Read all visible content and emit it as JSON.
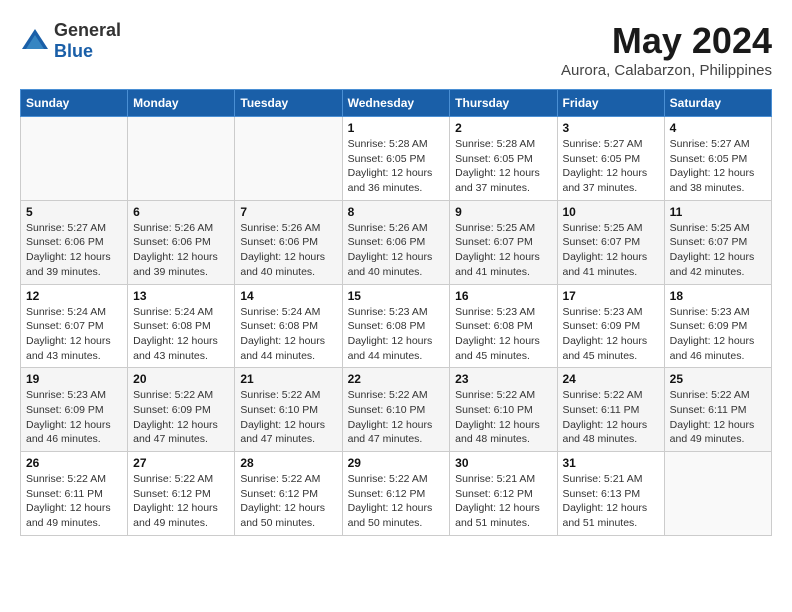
{
  "logo": {
    "general": "General",
    "blue": "Blue"
  },
  "title": "May 2024",
  "location": "Aurora, Calabarzon, Philippines",
  "days_header": [
    "Sunday",
    "Monday",
    "Tuesday",
    "Wednesday",
    "Thursday",
    "Friday",
    "Saturday"
  ],
  "weeks": [
    [
      {
        "day": "",
        "info": ""
      },
      {
        "day": "",
        "info": ""
      },
      {
        "day": "",
        "info": ""
      },
      {
        "day": "1",
        "info": "Sunrise: 5:28 AM\nSunset: 6:05 PM\nDaylight: 12 hours\nand 36 minutes."
      },
      {
        "day": "2",
        "info": "Sunrise: 5:28 AM\nSunset: 6:05 PM\nDaylight: 12 hours\nand 37 minutes."
      },
      {
        "day": "3",
        "info": "Sunrise: 5:27 AM\nSunset: 6:05 PM\nDaylight: 12 hours\nand 37 minutes."
      },
      {
        "day": "4",
        "info": "Sunrise: 5:27 AM\nSunset: 6:05 PM\nDaylight: 12 hours\nand 38 minutes."
      }
    ],
    [
      {
        "day": "5",
        "info": "Sunrise: 5:27 AM\nSunset: 6:06 PM\nDaylight: 12 hours\nand 39 minutes."
      },
      {
        "day": "6",
        "info": "Sunrise: 5:26 AM\nSunset: 6:06 PM\nDaylight: 12 hours\nand 39 minutes."
      },
      {
        "day": "7",
        "info": "Sunrise: 5:26 AM\nSunset: 6:06 PM\nDaylight: 12 hours\nand 40 minutes."
      },
      {
        "day": "8",
        "info": "Sunrise: 5:26 AM\nSunset: 6:06 PM\nDaylight: 12 hours\nand 40 minutes."
      },
      {
        "day": "9",
        "info": "Sunrise: 5:25 AM\nSunset: 6:07 PM\nDaylight: 12 hours\nand 41 minutes."
      },
      {
        "day": "10",
        "info": "Sunrise: 5:25 AM\nSunset: 6:07 PM\nDaylight: 12 hours\nand 41 minutes."
      },
      {
        "day": "11",
        "info": "Sunrise: 5:25 AM\nSunset: 6:07 PM\nDaylight: 12 hours\nand 42 minutes."
      }
    ],
    [
      {
        "day": "12",
        "info": "Sunrise: 5:24 AM\nSunset: 6:07 PM\nDaylight: 12 hours\nand 43 minutes."
      },
      {
        "day": "13",
        "info": "Sunrise: 5:24 AM\nSunset: 6:08 PM\nDaylight: 12 hours\nand 43 minutes."
      },
      {
        "day": "14",
        "info": "Sunrise: 5:24 AM\nSunset: 6:08 PM\nDaylight: 12 hours\nand 44 minutes."
      },
      {
        "day": "15",
        "info": "Sunrise: 5:23 AM\nSunset: 6:08 PM\nDaylight: 12 hours\nand 44 minutes."
      },
      {
        "day": "16",
        "info": "Sunrise: 5:23 AM\nSunset: 6:08 PM\nDaylight: 12 hours\nand 45 minutes."
      },
      {
        "day": "17",
        "info": "Sunrise: 5:23 AM\nSunset: 6:09 PM\nDaylight: 12 hours\nand 45 minutes."
      },
      {
        "day": "18",
        "info": "Sunrise: 5:23 AM\nSunset: 6:09 PM\nDaylight: 12 hours\nand 46 minutes."
      }
    ],
    [
      {
        "day": "19",
        "info": "Sunrise: 5:23 AM\nSunset: 6:09 PM\nDaylight: 12 hours\nand 46 minutes."
      },
      {
        "day": "20",
        "info": "Sunrise: 5:22 AM\nSunset: 6:09 PM\nDaylight: 12 hours\nand 47 minutes."
      },
      {
        "day": "21",
        "info": "Sunrise: 5:22 AM\nSunset: 6:10 PM\nDaylight: 12 hours\nand 47 minutes."
      },
      {
        "day": "22",
        "info": "Sunrise: 5:22 AM\nSunset: 6:10 PM\nDaylight: 12 hours\nand 47 minutes."
      },
      {
        "day": "23",
        "info": "Sunrise: 5:22 AM\nSunset: 6:10 PM\nDaylight: 12 hours\nand 48 minutes."
      },
      {
        "day": "24",
        "info": "Sunrise: 5:22 AM\nSunset: 6:11 PM\nDaylight: 12 hours\nand 48 minutes."
      },
      {
        "day": "25",
        "info": "Sunrise: 5:22 AM\nSunset: 6:11 PM\nDaylight: 12 hours\nand 49 minutes."
      }
    ],
    [
      {
        "day": "26",
        "info": "Sunrise: 5:22 AM\nSunset: 6:11 PM\nDaylight: 12 hours\nand 49 minutes."
      },
      {
        "day": "27",
        "info": "Sunrise: 5:22 AM\nSunset: 6:12 PM\nDaylight: 12 hours\nand 49 minutes."
      },
      {
        "day": "28",
        "info": "Sunrise: 5:22 AM\nSunset: 6:12 PM\nDaylight: 12 hours\nand 50 minutes."
      },
      {
        "day": "29",
        "info": "Sunrise: 5:22 AM\nSunset: 6:12 PM\nDaylight: 12 hours\nand 50 minutes."
      },
      {
        "day": "30",
        "info": "Sunrise: 5:21 AM\nSunset: 6:12 PM\nDaylight: 12 hours\nand 51 minutes."
      },
      {
        "day": "31",
        "info": "Sunrise: 5:21 AM\nSunset: 6:13 PM\nDaylight: 12 hours\nand 51 minutes."
      },
      {
        "day": "",
        "info": ""
      }
    ]
  ]
}
